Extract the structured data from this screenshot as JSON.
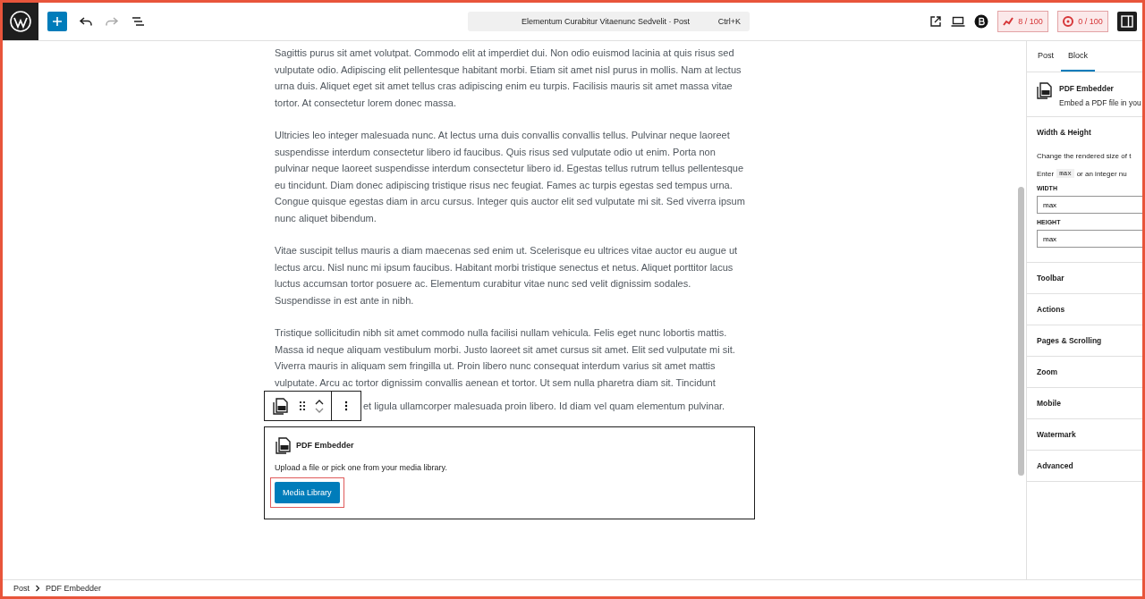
{
  "topbar": {
    "command": {
      "title": "Elementum Curabitur Vitaenunc Sedvelit · Post",
      "shortcut": "Ctrl+K"
    },
    "scores": [
      {
        "kind": "seo",
        "value": "8 / 100"
      },
      {
        "kind": "readability",
        "value": "0 / 100"
      }
    ]
  },
  "editor": {
    "paragraphs": [
      "Sagittis purus sit amet volutpat. Commodo elit at imperdiet dui. Non odio euismod lacinia at quis risus sed vulputate odio. Adipiscing elit pellentesque habitant morbi. Etiam sit amet nisl purus in mollis. Nam at lectus urna duis. Aliquet eget sit amet tellus cras adipiscing enim eu turpis. Facilisis mauris sit amet massa vitae tortor. At consectetur lorem donec massa.",
      "Ultricies leo integer malesuada nunc. At lectus urna duis convallis convallis tellus. Pulvinar neque laoreet suspendisse interdum consectetur libero id faucibus. Quis risus sed vulputate odio ut enim. Porta non pulvinar neque laoreet suspendisse interdum consectetur libero id. Egestas tellus rutrum tellus pellentesque eu tincidunt. Diam donec adipiscing tristique risus nec feugiat. Fames ac turpis egestas sed tempus urna. Congue quisque egestas diam in arcu cursus. Integer quis auctor elit sed vulputate mi sit. Sed viverra ipsum nunc aliquet bibendum.",
      "Vitae suscipit tellus mauris a diam maecenas sed enim ut. Scelerisque eu ultrices vitae auctor eu augue ut lectus arcu. Nisl nunc mi ipsum faucibus. Habitant morbi tristique senectus et netus. Aliquet porttitor lacus luctus accumsan tortor posuere ac. Elementum curabitur vitae nunc sed velit dignissim sodales. Suspendisse in est ante in nibh.",
      "Tristique sollicitudin nibh sit amet commodo nulla facilisi nullam vehicula. Felis eget nunc lobortis mattis. Massa id neque aliquam vestibulum morbi. Justo laoreet sit amet cursus sit amet. Elit sed vulputate mi sit. Viverra mauris in aliquam sem fringilla ut. Proin libero nunc consequat interdum varius sit amet mattis vulputate. Arcu ac tortor dignissim convallis aenean et tortor. Ut sem nulla pharetra diam sit. Tincidunt"
    ],
    "partly_hidden_line": "et ligula ullamcorper malesuada proin libero. Id diam vel quam elementum pulvinar.",
    "block": {
      "title": "PDF Embedder",
      "instructions": "Upload a file or pick one from your media library.",
      "button": "Media Library"
    }
  },
  "sidebar": {
    "tabs": [
      {
        "label": "Post",
        "selected": false
      },
      {
        "label": "Block",
        "selected": true
      }
    ],
    "block_card": {
      "title": "PDF Embedder",
      "description": "Embed a PDF file in you"
    },
    "width_height": {
      "title": "Width & Height",
      "help": "Change the rendered size of t",
      "hint": {
        "before": "Enter",
        "code": "max",
        "after": "or an integer nu"
      },
      "fields": [
        {
          "label": "WIDTH",
          "value": "max"
        },
        {
          "label": "HEIGHT",
          "value": "max"
        }
      ]
    },
    "panels": [
      "Toolbar",
      "Actions",
      "Pages & Scrolling",
      "Zoom",
      "Mobile",
      "Watermark",
      "Advanced"
    ]
  },
  "breadcrumb": [
    "Post",
    "PDF Embedder"
  ]
}
